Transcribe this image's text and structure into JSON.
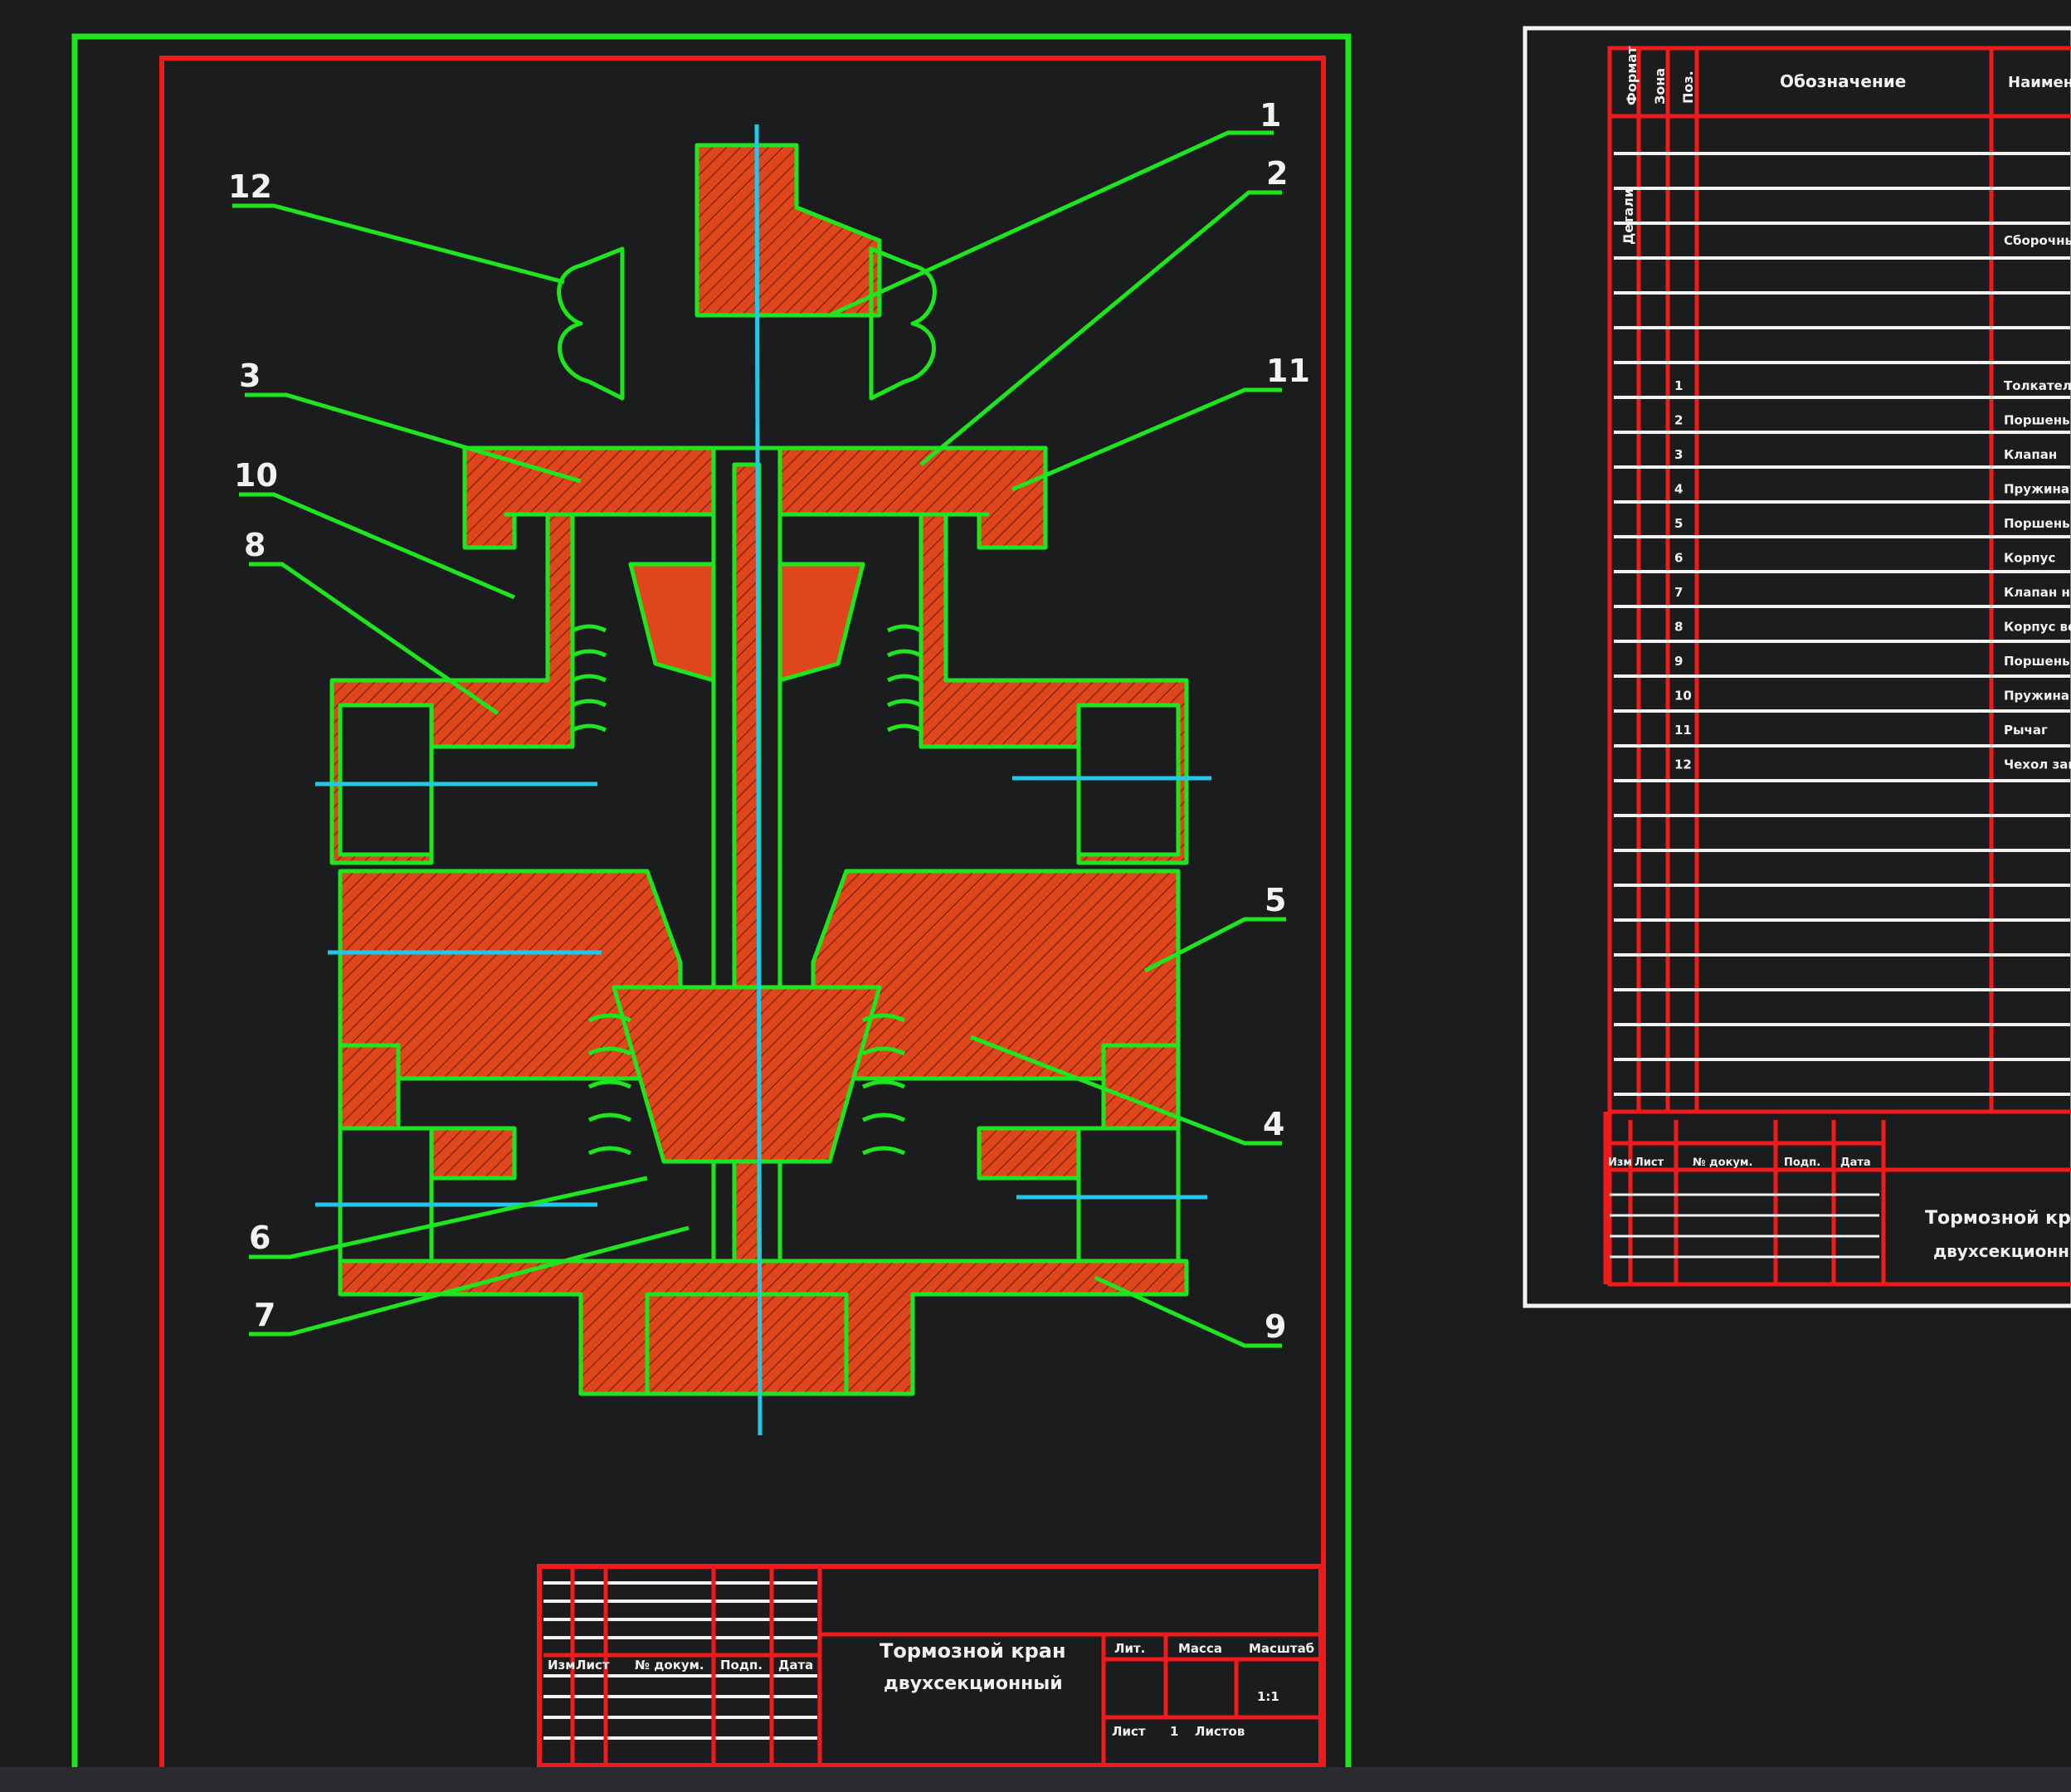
{
  "colors": {
    "background": "#1b1c1e",
    "frame_green": "#1ee61e",
    "frame_red": "#f01a1a",
    "hatch_fill": "#e0461c",
    "axis_cyan": "#22c8e8",
    "sheet_white": "#f2f2f2"
  },
  "main_drawing": {
    "callouts": [
      "1",
      "2",
      "3",
      "4",
      "5",
      "6",
      "7",
      "8",
      "9",
      "10",
      "11",
      "12"
    ]
  },
  "title_block": {
    "drawing_name": "Тормозной кран",
    "drawing_subtitle": "двухсекционный",
    "col_labels": [
      "Изм",
      "Лист",
      "№ докум.",
      "Подп.",
      "Дата"
    ],
    "stage_labels": [
      "Лит.",
      "Масса",
      "Масштаб"
    ],
    "sheet_label": "Лист",
    "sheets_label": "Листов",
    "sheet_value": "1",
    "scale_value": "1:1"
  },
  "specification_sheet": {
    "header": {
      "format": "Формат",
      "zone": "Зона",
      "pos": "Поз.",
      "designation": "Обозначение",
      "name": "Наименование"
    },
    "rows": [
      {
        "pos": "1",
        "name": "Толкатель"
      },
      {
        "pos": "2",
        "name": "Поршень"
      },
      {
        "pos": "3",
        "name": "Клапан"
      },
      {
        "pos": "4",
        "name": "Пружина ниж."
      },
      {
        "pos": "5",
        "name": "Поршень большой"
      },
      {
        "pos": "6",
        "name": "Корпус"
      },
      {
        "pos": "7",
        "name": "Клапан нижний"
      },
      {
        "pos": "8",
        "name": "Корпус верхний"
      },
      {
        "pos": "9",
        "name": "Поршень малый"
      },
      {
        "pos": "10",
        "name": "Пружина верх."
      },
      {
        "pos": "11",
        "name": "Рычаг"
      },
      {
        "pos": "12",
        "name": "Чехол защитный"
      }
    ],
    "section_label": "Детали",
    "section_text": "Сборочные единицы",
    "title_name": "Тормозной кран",
    "title_subtitle": "двухсекционный",
    "col_labels": [
      "Изм",
      "Лист",
      "№ докум.",
      "Подп.",
      "Дата"
    ]
  }
}
